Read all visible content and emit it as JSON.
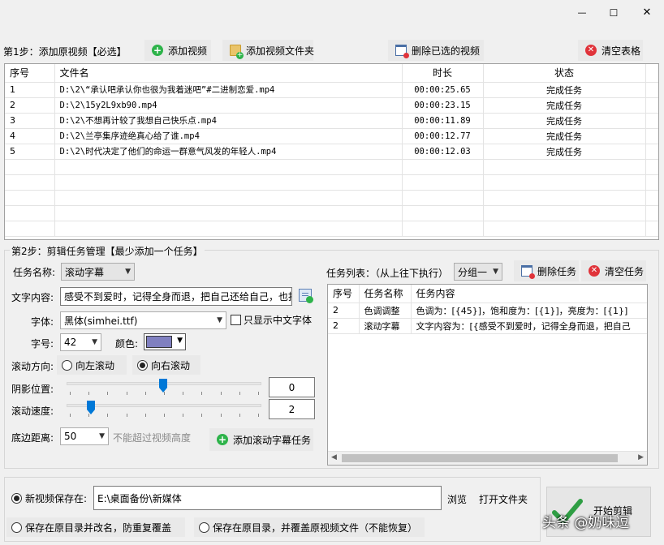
{
  "window": {
    "minimize": "—",
    "maximize": "☐",
    "close": "✕"
  },
  "step1": {
    "label": "第1步：添加原视频【必选】",
    "add_video": "添加视频",
    "add_folder": "添加视频文件夹",
    "delete_selected": "删除已选的视频",
    "clear_table": "清空表格",
    "columns": [
      "序号",
      "文件名",
      "时长",
      "状态"
    ],
    "rows": [
      {
        "no": "1",
        "file": "D:\\2\\“承认吧承认你也很为我着迷吧”#二进制恋爱.mp4",
        "duration": "00:00:25.65",
        "status": "完成任务"
      },
      {
        "no": "2",
        "file": "D:\\2\\15y2L9xb90.mp4",
        "duration": "00:00:23.15",
        "status": "完成任务"
      },
      {
        "no": "3",
        "file": "D:\\2\\不想再计较了我想自己快乐点.mp4",
        "duration": "00:00:11.89",
        "status": "完成任务"
      },
      {
        "no": "4",
        "file": "D:\\2\\兰亭集序迹绝真心给了谁.mp4",
        "duration": "00:00:12.77",
        "status": "完成任务"
      },
      {
        "no": "5",
        "file": "D:\\2\\时代决定了他们的命运一群意气风发的年轻人.mp4",
        "duration": "00:00:12.03",
        "status": "完成任务"
      }
    ]
  },
  "step2": {
    "label": "第2步：剪辑任务管理【最少添加一个任务】",
    "task_name_label": "任务名称:",
    "task_name_value": "滚动字幕",
    "text_content_label": "文字内容:",
    "text_content_value": "感受不到爱时，记得全身而退，把自己还给自己，也拒",
    "font_label": "字体:",
    "font_value": "黑体(simhei.ttf)",
    "only_chinese": "只显示中文字体",
    "size_label": "字号:",
    "size_value": "42",
    "color_label": "颜色:",
    "color_value": "#8080c0",
    "direction_label": "滚动方向:",
    "dir_left": "向左滚动",
    "dir_right": "向右滚动",
    "shadow_label": "阴影位置:",
    "shadow_value": "0",
    "speed_label": "滚动速度:",
    "speed_value": "2",
    "bottom_label": "底边距离:",
    "bottom_value": "50",
    "bottom_hint": "不能超过视频高度",
    "add_task": "添加滚动字幕任务",
    "task_list_label": "任务列表：（从上往下执行）",
    "group_value": "分组一",
    "delete_task": "删除任务",
    "clear_tasks": "清空任务",
    "task_columns": [
      "序号",
      "任务名称",
      "任务内容"
    ],
    "tasks": [
      {
        "no": "2",
        "name": "色调调整",
        "content": "色调为：[{45}]，饱和度为：[{1}]，亮度为：[{1}]"
      },
      {
        "no": "2",
        "name": "滚动字幕",
        "content": "文字内容为：[{感受不到爱时，记得全身而退，把自己"
      }
    ]
  },
  "output": {
    "save_new_label": "新视频保存在:",
    "save_path": "E:\\桌面备份\\新媒体",
    "browse": "浏览",
    "open_folder": "打开文件夹",
    "save_rename": "保存在原目录并改名，防重复覆盖",
    "save_overwrite": "保存在原目录，并覆盖原视频文件（不能恢复）",
    "start": "开始剪辑"
  },
  "watermark": "头条 @奶味逗"
}
